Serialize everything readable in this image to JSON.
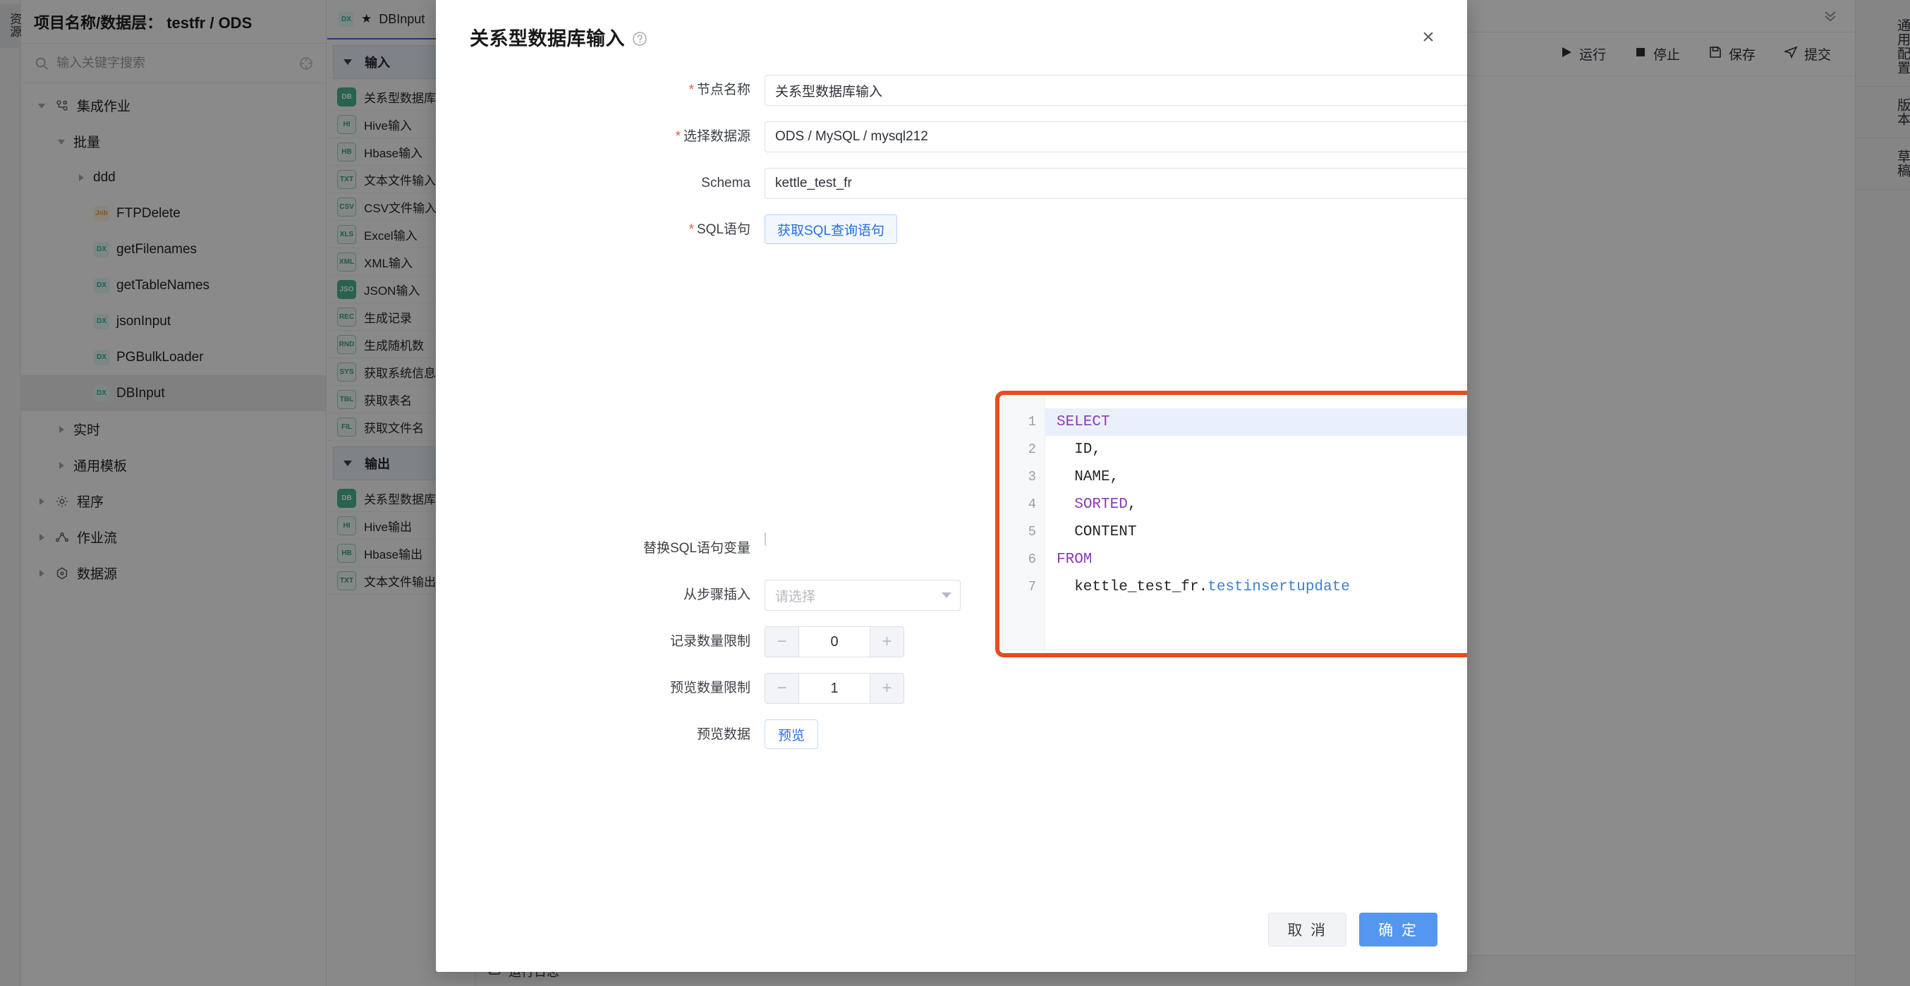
{
  "left_rail": {
    "tab_label": "资源"
  },
  "sidebar": {
    "header_title": "项目名称/数据层： testfr / ODS",
    "search": {
      "placeholder": "输入关键字搜索",
      "value": ""
    },
    "tree": [
      {
        "label": "集成作业",
        "indent": 0,
        "caret": "open",
        "icon": "job-flow",
        "selected": false
      },
      {
        "label": "批量",
        "indent": 1,
        "caret": "open",
        "icon": "none",
        "selected": false
      },
      {
        "label": "ddd",
        "indent": 2,
        "caret": "closed",
        "icon": "none",
        "selected": false
      },
      {
        "label": "FTPDelete",
        "indent": 2,
        "caret": "none",
        "icon": "job",
        "selected": false
      },
      {
        "label": "getFilenames",
        "indent": 2,
        "caret": "none",
        "icon": "tx",
        "selected": false
      },
      {
        "label": "getTableNames",
        "indent": 2,
        "caret": "none",
        "icon": "tx",
        "selected": false
      },
      {
        "label": "jsonInput",
        "indent": 2,
        "caret": "none",
        "icon": "tx",
        "selected": false
      },
      {
        "label": "PGBulkLoader",
        "indent": 2,
        "caret": "none",
        "icon": "tx",
        "selected": false
      },
      {
        "label": "DBInput",
        "indent": 2,
        "caret": "none",
        "icon": "tx",
        "selected": true
      },
      {
        "label": "实时",
        "indent": 1,
        "caret": "closed",
        "icon": "none",
        "selected": false
      },
      {
        "label": "通用模板",
        "indent": 1,
        "caret": "closed",
        "icon": "none",
        "selected": false
      },
      {
        "label": "程序",
        "indent": 0,
        "caret": "closed",
        "icon": "gear",
        "selected": false
      },
      {
        "label": "作业流",
        "indent": 0,
        "caret": "closed",
        "icon": "flow",
        "selected": false
      },
      {
        "label": "数据源",
        "indent": 0,
        "caret": "closed",
        "icon": "db",
        "selected": false
      }
    ]
  },
  "palette": {
    "tab": {
      "label": "DBInput",
      "starred": true,
      "icon": "tx"
    },
    "sections": [
      {
        "group_label": "输入",
        "items": [
          {
            "label": "关系型数据库输入",
            "icon": "db",
            "solid": true
          },
          {
            "label": "Hive输入",
            "icon": "HI",
            "solid": false
          },
          {
            "label": "Hbase输入",
            "icon": "hb",
            "solid": false
          },
          {
            "label": "文本文件输入",
            "icon": "txt",
            "solid": false
          },
          {
            "label": "CSV文件输入",
            "icon": "csv",
            "solid": false
          },
          {
            "label": "Excel输入",
            "icon": "xls",
            "solid": false
          },
          {
            "label": "XML输入",
            "icon": "xml",
            "solid": false
          },
          {
            "label": "JSON输入",
            "icon": "json",
            "solid": true
          },
          {
            "label": "生成记录",
            "icon": "rec",
            "solid": false
          },
          {
            "label": "生成随机数",
            "icon": "rnd",
            "solid": false
          },
          {
            "label": "获取系统信息",
            "icon": "sys",
            "solid": false
          },
          {
            "label": "获取表名",
            "icon": "tbl",
            "solid": false
          },
          {
            "label": "获取文件名",
            "icon": "file",
            "solid": false
          }
        ]
      },
      {
        "group_label": "输出",
        "items": [
          {
            "label": "关系型数据库输出",
            "icon": "db",
            "solid": true
          },
          {
            "label": "Hive输出",
            "icon": "HI",
            "solid": false
          },
          {
            "label": "Hbase输出",
            "icon": "hb",
            "solid": false
          },
          {
            "label": "文本文件输出",
            "icon": "txt",
            "solid": false
          }
        ]
      }
    ]
  },
  "toolbar": {
    "run_label": "运行",
    "stop_label": "停止",
    "save_label": "保存",
    "submit_label": "提交"
  },
  "status_bar": {
    "log_label": "运行日志"
  },
  "right_rail": {
    "tabs": [
      {
        "label": "通用配置"
      },
      {
        "label": "版本"
      },
      {
        "label": "草稿"
      }
    ]
  },
  "modal": {
    "title": "关系型数据库输入",
    "close_label": "×",
    "fields": {
      "node_name": {
        "label": "节点名称",
        "required": true,
        "value": "关系型数据库输入"
      },
      "datasource": {
        "label": "选择数据源",
        "required": true,
        "value": "ODS / MySQL / mysql212"
      },
      "schema": {
        "label": "Schema",
        "required": false,
        "value": "kettle_test_fr"
      },
      "sql": {
        "label": "SQL语句",
        "required": true,
        "button_label": "获取SQL查询语句"
      },
      "replace_var": {
        "label": "替换SQL语句变量",
        "checked": false
      },
      "insert_step": {
        "label": "从步骤插入",
        "placeholder": "请选择",
        "value": ""
      },
      "record_limit": {
        "label": "记录数量限制",
        "value": "0",
        "minus": "−",
        "plus": "+"
      },
      "preview_limit": {
        "label": "预览数量限制",
        "value": "1",
        "minus": "−",
        "plus": "+"
      },
      "preview_data": {
        "label": "预览数据",
        "button_label": "预览"
      }
    },
    "sql_editor": {
      "lines": [
        {
          "num": "1",
          "active": true,
          "tokens": [
            {
              "t": "SELECT",
              "c": "kw"
            }
          ]
        },
        {
          "num": "2",
          "active": false,
          "tokens": [
            {
              "t": "  ID,",
              "c": ""
            }
          ]
        },
        {
          "num": "3",
          "active": false,
          "tokens": [
            {
              "t": "  NAME,",
              "c": ""
            }
          ]
        },
        {
          "num": "4",
          "active": false,
          "tokens": [
            {
              "t": "  ",
              "c": ""
            },
            {
              "t": "SORTED",
              "c": "kw"
            },
            {
              "t": ",",
              "c": ""
            }
          ]
        },
        {
          "num": "5",
          "active": false,
          "tokens": [
            {
              "t": "  CONTENT",
              "c": ""
            }
          ]
        },
        {
          "num": "6",
          "active": false,
          "tokens": [
            {
              "t": "FROM",
              "c": "kw"
            }
          ]
        },
        {
          "num": "7",
          "active": false,
          "tokens": [
            {
              "t": "  kettle_test_fr.",
              "c": ""
            },
            {
              "t": "testinsertupdate",
              "c": "tbl"
            }
          ]
        }
      ],
      "annotation_color": "#ea4a21"
    },
    "footer": {
      "cancel_label": "取 消",
      "confirm_label": "确 定"
    }
  },
  "colors": {
    "primary": "#5596f0",
    "link": "#2a6fe0",
    "annotation": "#ea4a21",
    "required": "#e5554e"
  }
}
